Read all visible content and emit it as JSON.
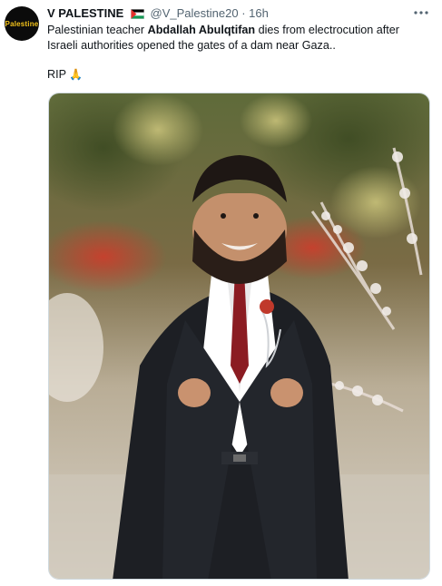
{
  "tweet": {
    "avatar": {
      "label": "Palestine"
    },
    "author": {
      "name": "V PALESTINE",
      "handle": "@V_Palestine20",
      "separator": "·",
      "time": "16h"
    },
    "more_icon": "more-horizontal-icon",
    "text": {
      "part1": "Palestinian teacher ",
      "bold_name": "Abdallah Abulqtifan",
      "part2": " dies from electrocution after Israeli authorities opened the gates of a dam near Gaza..",
      "rip": "RIP",
      "emoji": "🙏"
    },
    "media": {
      "type": "photo"
    }
  },
  "colors": {
    "name": "#0f1419",
    "muted": "#536471",
    "avatar_bg": "#0b0b0b",
    "avatar_text": "#f2c21b",
    "border": "#cfd9de"
  }
}
